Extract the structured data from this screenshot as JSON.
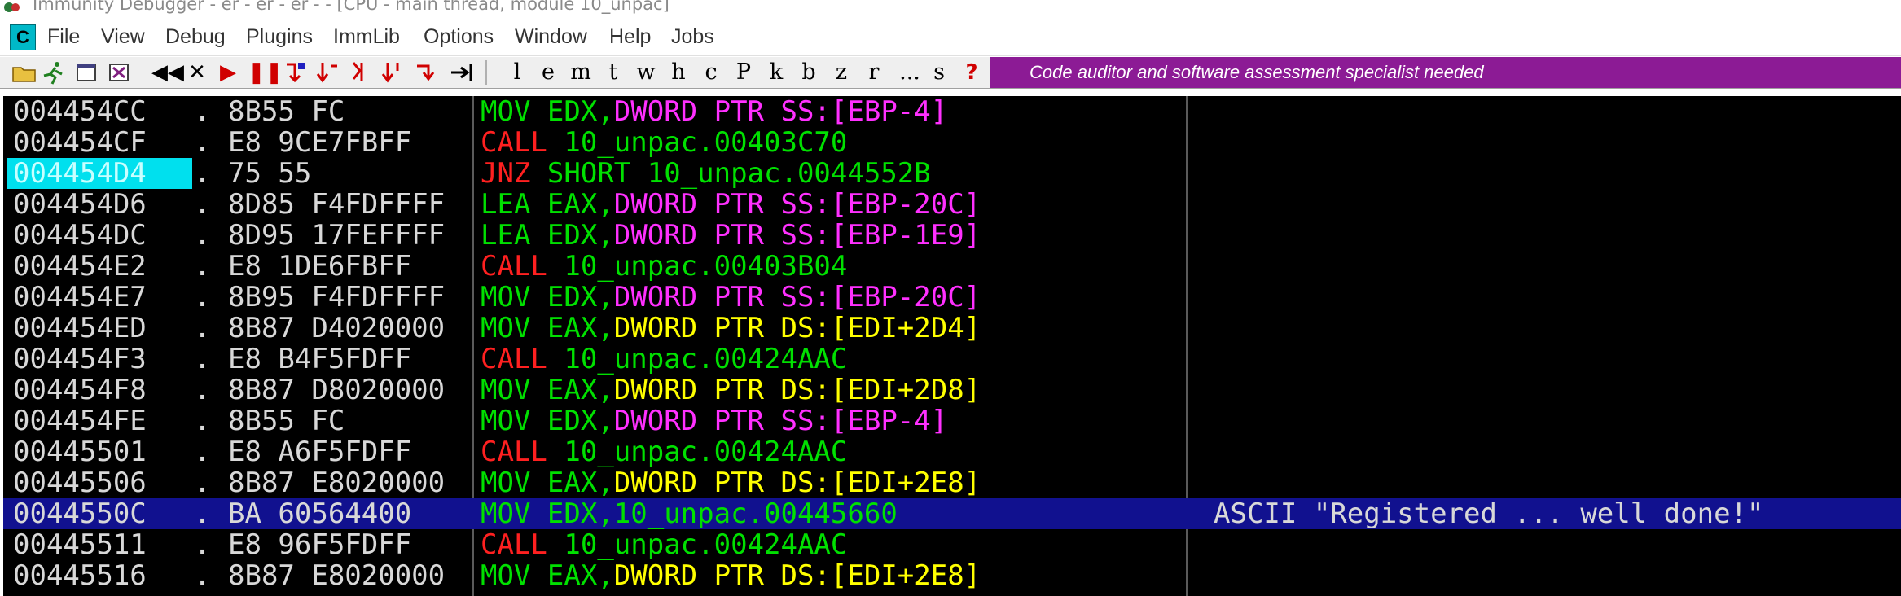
{
  "window": {
    "title": "Immunity Debugger - er - er - er -  - [CPU - main thread, module 10_unpac]"
  },
  "menu": {
    "cpu_icon_label": "C",
    "items": [
      "File",
      "View",
      "Debug",
      "Plugins",
      "ImmLib",
      "Options",
      "Window",
      "Help",
      "Jobs"
    ]
  },
  "toolbar": {
    "letters": [
      "l",
      "e",
      "m",
      "t",
      "w",
      "h",
      "c",
      "P",
      "k",
      "b",
      "z",
      "r",
      "...",
      "s",
      "?"
    ],
    "banner_text": "Code auditor and software assessment specialist needed",
    "banner_color": "#8c1b95"
  },
  "colors": {
    "background": "#000000",
    "selected_row": "#11118f",
    "eip_highlight": "#00e0ee",
    "mnemonic_mov": "#00e000",
    "mnemonic_call": "#ff2020",
    "mem_ss": "#ff30ff",
    "mem_ds": "#ffff00"
  },
  "disassembly": [
    {
      "addr": "004454CC",
      "mark": ".",
      "hex": "8B55 FC",
      "mnemonic": "MOV",
      "mclass": "mov",
      "ops": [
        [
          "EDX,",
          "reg"
        ],
        [
          "DWORD PTR SS:[EBP-4]",
          "ss"
        ]
      ],
      "comment": ""
    },
    {
      "addr": "004454CF",
      "mark": ".",
      "hex": "E8 9CE7FBFF",
      "mnemonic": "CALL",
      "mclass": "call",
      "ops": [
        [
          "10_unpac.00403C70",
          "target"
        ]
      ],
      "comment": ""
    },
    {
      "addr": "004454D4",
      "mark": ".",
      "hex": "75 55",
      "mnemonic": "JNZ",
      "mclass": "jnz",
      "ops": [
        [
          "SHORT 10_unpac.0044552B",
          "target"
        ]
      ],
      "comment": "",
      "eip": true
    },
    {
      "addr": "004454D6",
      "mark": ".",
      "hex": "8D85 F4FDFFFF",
      "mnemonic": "LEA",
      "mclass": "lea",
      "ops": [
        [
          "EAX,",
          "reg"
        ],
        [
          "DWORD PTR SS:[EBP-20C]",
          "ss"
        ]
      ],
      "comment": ""
    },
    {
      "addr": "004454DC",
      "mark": ".",
      "hex": "8D95 17FEFFFF",
      "mnemonic": "LEA",
      "mclass": "lea",
      "ops": [
        [
          "EDX,",
          "reg"
        ],
        [
          "DWORD PTR SS:[EBP-1E9]",
          "ss"
        ]
      ],
      "comment": ""
    },
    {
      "addr": "004454E2",
      "mark": ".",
      "hex": "E8 1DE6FBFF",
      "mnemonic": "CALL",
      "mclass": "call",
      "ops": [
        [
          "10_unpac.00403B04",
          "target"
        ]
      ],
      "comment": ""
    },
    {
      "addr": "004454E7",
      "mark": ".",
      "hex": "8B95 F4FDFFFF",
      "mnemonic": "MOV",
      "mclass": "mov",
      "ops": [
        [
          "EDX,",
          "reg"
        ],
        [
          "DWORD PTR SS:[EBP-20C]",
          "ss"
        ]
      ],
      "comment": ""
    },
    {
      "addr": "004454ED",
      "mark": ".",
      "hex": "8B87 D4020000",
      "mnemonic": "MOV",
      "mclass": "mov",
      "ops": [
        [
          "EAX,",
          "reg"
        ],
        [
          "DWORD PTR DS:[EDI+2D4]",
          "ds"
        ]
      ],
      "comment": ""
    },
    {
      "addr": "004454F3",
      "mark": ".",
      "hex": "E8 B4F5FDFF",
      "mnemonic": "CALL",
      "mclass": "call",
      "ops": [
        [
          "10_unpac.00424AAC",
          "target"
        ]
      ],
      "comment": ""
    },
    {
      "addr": "004454F8",
      "mark": ".",
      "hex": "8B87 D8020000",
      "mnemonic": "MOV",
      "mclass": "mov",
      "ops": [
        [
          "EAX,",
          "reg"
        ],
        [
          "DWORD PTR DS:[EDI+2D8]",
          "ds"
        ]
      ],
      "comment": ""
    },
    {
      "addr": "004454FE",
      "mark": ".",
      "hex": "8B55 FC",
      "mnemonic": "MOV",
      "mclass": "mov",
      "ops": [
        [
          "EDX,",
          "reg"
        ],
        [
          "DWORD PTR SS:[EBP-4]",
          "ss"
        ]
      ],
      "comment": ""
    },
    {
      "addr": "00445501",
      "mark": ".",
      "hex": "E8 A6F5FDFF",
      "mnemonic": "CALL",
      "mclass": "call",
      "ops": [
        [
          "10_unpac.00424AAC",
          "target"
        ]
      ],
      "comment": ""
    },
    {
      "addr": "00445506",
      "mark": ".",
      "hex": "8B87 E8020000",
      "mnemonic": "MOV",
      "mclass": "mov",
      "ops": [
        [
          "EAX,",
          "reg"
        ],
        [
          "DWORD PTR DS:[EDI+2E8]",
          "ds"
        ]
      ],
      "comment": ""
    },
    {
      "addr": "0044550C",
      "mark": ".",
      "hex": "BA 60564400",
      "mnemonic": "MOV",
      "mclass": "mov",
      "ops": [
        [
          "EDX,",
          "reg"
        ],
        [
          "10_unpac.00445660",
          "imm"
        ]
      ],
      "comment": "ASCII \"Registered ... well done!\"",
      "selected": true
    },
    {
      "addr": "00445511",
      "mark": ".",
      "hex": "E8 96F5FDFF",
      "mnemonic": "CALL",
      "mclass": "call",
      "ops": [
        [
          "10_unpac.00424AAC",
          "target"
        ]
      ],
      "comment": ""
    },
    {
      "addr": "00445516",
      "mark": ".",
      "hex": "8B87 E8020000",
      "mnemonic": "MOV",
      "mclass": "mov",
      "ops": [
        [
          "EAX,",
          "reg"
        ],
        [
          "DWORD PTR DS:[EDI+2E8]",
          "ds"
        ]
      ],
      "comment": ""
    }
  ]
}
